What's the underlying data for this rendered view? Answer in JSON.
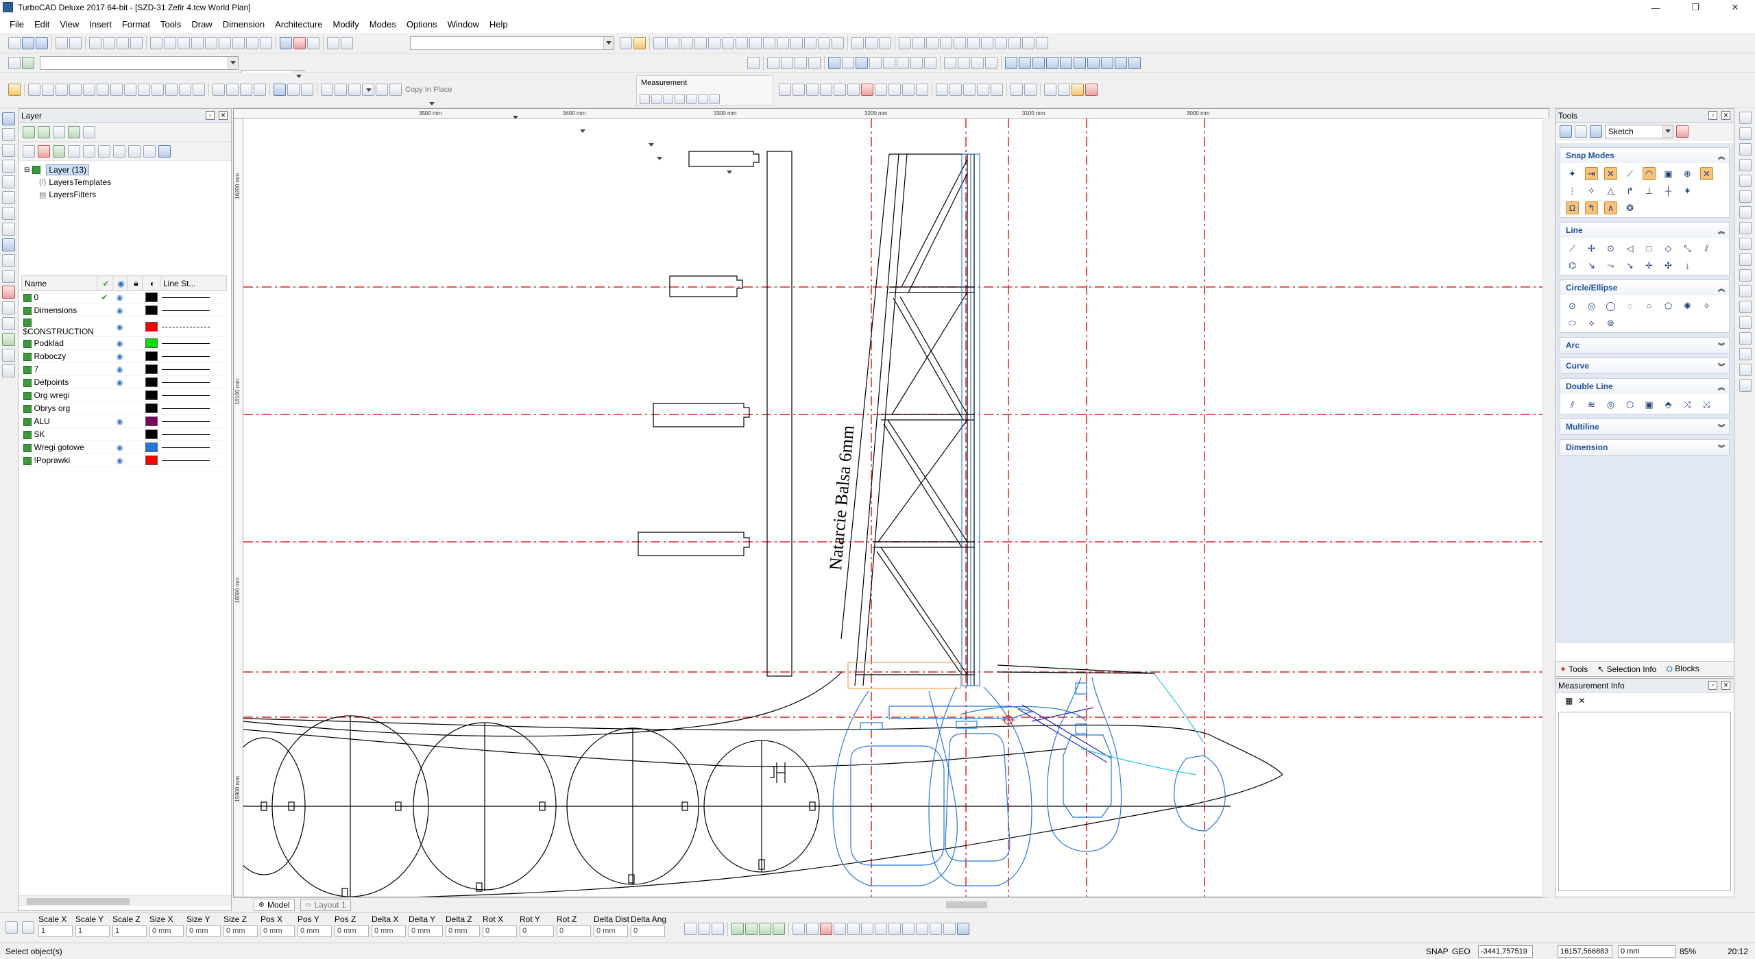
{
  "window": {
    "title": "TurboCAD Deluxe 2017 64-bit - [SZD-31 Zefir 4.tcw World Plan]",
    "controls": [
      "—",
      "❐",
      "✕"
    ]
  },
  "menu": [
    "File",
    "Edit",
    "View",
    "Insert",
    "Format",
    "Tools",
    "Draw",
    "Dimension",
    "Architecture",
    "Modify",
    "Modes",
    "Options",
    "Window",
    "Help"
  ],
  "toolbar": {
    "copy_in_place": "Copy In Place",
    "measurement": "Measurement"
  },
  "layer_panel": {
    "title": "Layer",
    "tree": {
      "root": "Layer (13)",
      "children": [
        "LayersTemplates",
        "LayersFilters"
      ]
    },
    "columns": {
      "name": "Name",
      "line_style": "Line St..."
    },
    "layers": [
      {
        "name": "0",
        "active": true,
        "visible": true,
        "color": "#000000",
        "style": "solid"
      },
      {
        "name": "Dimensions",
        "active": false,
        "visible": true,
        "color": "#000000",
        "style": "solid"
      },
      {
        "name": "$CONSTRUCTION",
        "active": false,
        "visible": true,
        "color": "#ff0000",
        "style": "dashdot"
      },
      {
        "name": "Podklad",
        "active": false,
        "visible": true,
        "color": "#00e000",
        "style": "solid"
      },
      {
        "name": "Roboczy",
        "active": false,
        "visible": true,
        "color": "#000000",
        "style": "solid"
      },
      {
        "name": "7",
        "active": false,
        "visible": true,
        "color": "#000000",
        "style": "solid"
      },
      {
        "name": "Defpoints",
        "active": false,
        "visible": true,
        "color": "#000000",
        "style": "solid"
      },
      {
        "name": "Org wregi",
        "active": false,
        "visible": false,
        "color": "#000000",
        "style": "solid"
      },
      {
        "name": "Obrys org",
        "active": false,
        "visible": false,
        "color": "#000000",
        "style": "solid"
      },
      {
        "name": "ALU",
        "active": false,
        "visible": true,
        "color": "#800060",
        "style": "solid"
      },
      {
        "name": "SK",
        "active": false,
        "visible": false,
        "color": "#000000",
        "style": "solid"
      },
      {
        "name": "Wregi gotowe",
        "active": false,
        "visible": true,
        "color": "#1e78e0",
        "style": "solid"
      },
      {
        "name": "!Poprawki",
        "active": false,
        "visible": true,
        "color": "#ff0000",
        "style": "solid"
      }
    ]
  },
  "drawing": {
    "annotation": "Natarcie Balsa 6mm",
    "ruler_top": [
      "3500 mm",
      "3400 mm",
      "3300 mm",
      "3200 mm",
      "3100 mm",
      "3000 mm"
    ],
    "ruler_left": [
      "16200 mm",
      "16100 mm",
      "16000 mm",
      "15900 mm"
    ],
    "tabs": [
      "Model",
      "Layout 1"
    ]
  },
  "tools_panel": {
    "title": "Tools",
    "mode": "Sketch",
    "sections": [
      {
        "name": "Snap Modes",
        "expanded": true
      },
      {
        "name": "Line",
        "expanded": true
      },
      {
        "name": "Circle/Ellipse",
        "expanded": true
      },
      {
        "name": "Arc",
        "expanded": false
      },
      {
        "name": "Curve",
        "expanded": false
      },
      {
        "name": "Double Line",
        "expanded": true
      },
      {
        "name": "Multiline",
        "expanded": false
      },
      {
        "name": "Dimension",
        "expanded": false
      }
    ],
    "bottom_tabs": [
      "Tools",
      "Selection Info",
      "Blocks"
    ]
  },
  "measurement_panel": {
    "title": "Measurement Info"
  },
  "inspector": {
    "fields": [
      {
        "label": "Scale X",
        "value": "1"
      },
      {
        "label": "Scale Y",
        "value": "1"
      },
      {
        "label": "Scale Z",
        "value": "1"
      },
      {
        "label": "Size X",
        "value": "0 mm"
      },
      {
        "label": "Size Y",
        "value": "0 mm"
      },
      {
        "label": "Size Z",
        "value": "0 mm"
      },
      {
        "label": "Pos X",
        "value": "0 mm"
      },
      {
        "label": "Pos Y",
        "value": "0 mm"
      },
      {
        "label": "Pos Z",
        "value": "0 mm"
      },
      {
        "label": "Delta X",
        "value": "0 mm"
      },
      {
        "label": "Delta Y",
        "value": "0 mm"
      },
      {
        "label": "Delta Z",
        "value": "0 mm"
      },
      {
        "label": "Rot X",
        "value": "0"
      },
      {
        "label": "Rot Y",
        "value": "0"
      },
      {
        "label": "Rot Z",
        "value": "0"
      },
      {
        "label": "Delta Dist",
        "value": "0 mm"
      },
      {
        "label": "Delta Ang",
        "value": "0"
      }
    ]
  },
  "status": {
    "message": "Select object(s)",
    "snap": "SNAP",
    "geo": "GEO",
    "x": "-3441,757519",
    "y": "16157,566883",
    "z": "0 mm",
    "zoom": "85%",
    "time": "20:12"
  }
}
